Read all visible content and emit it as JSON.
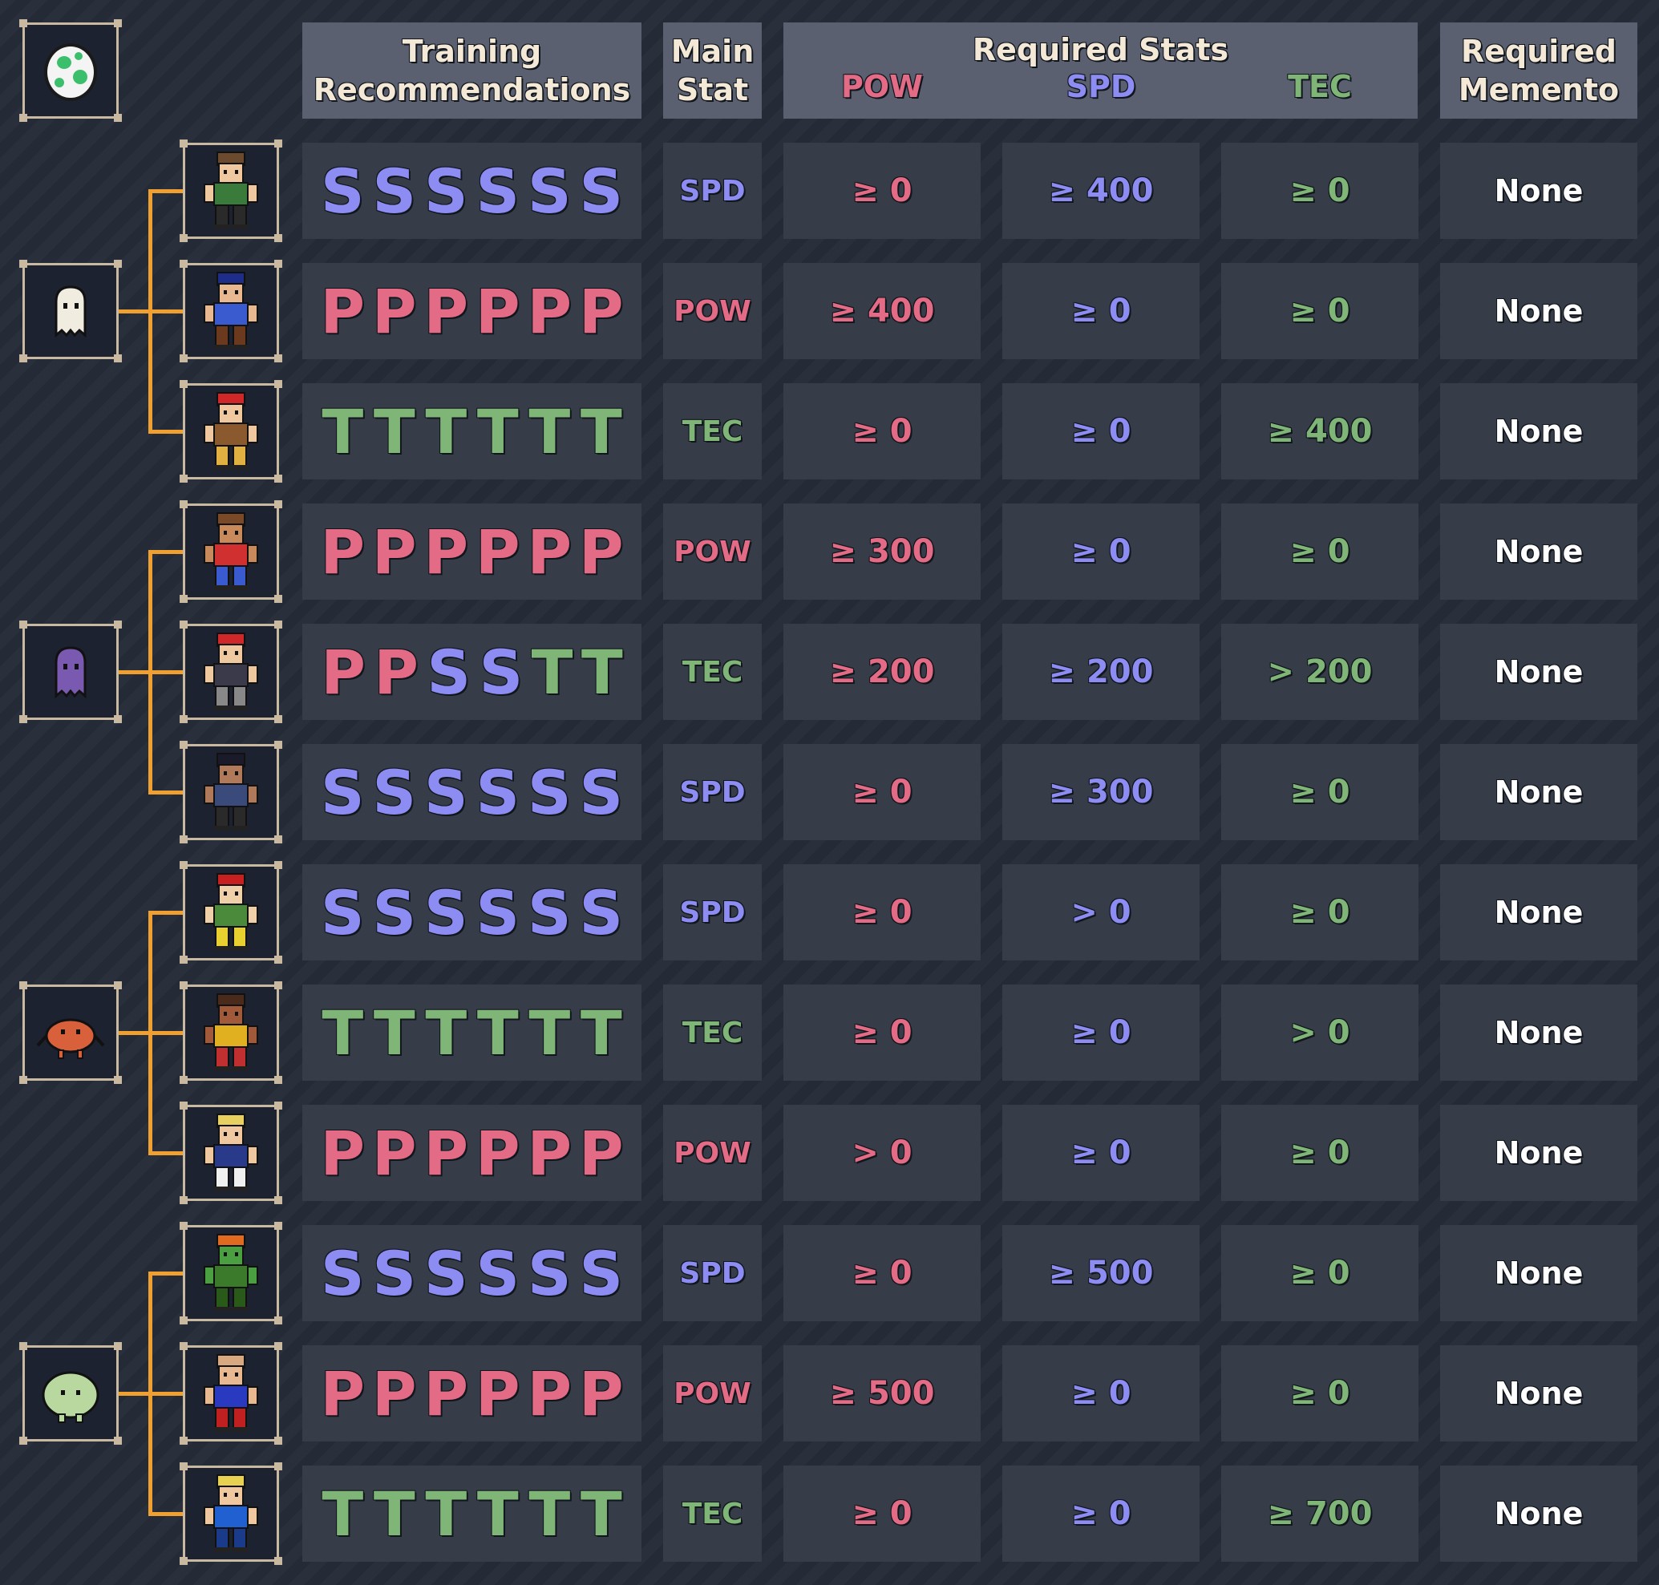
{
  "header": {
    "training_line1": "Training",
    "training_line2": "Recommendations",
    "main_line1": "Main",
    "main_line2": "Stat",
    "required_stats": "Required Stats",
    "pow": "POW",
    "spd": "SPD",
    "tec": "TEC",
    "memento_line1": "Required",
    "memento_line2": "Memento"
  },
  "colors": {
    "pow": "#e46b85",
    "spd": "#8c8cf2",
    "tec": "#7fb577",
    "connector": "#f0a030"
  },
  "groups": [
    {
      "baby_icon": "ghost-baby-icon",
      "rows": [
        0,
        1,
        2
      ]
    },
    {
      "baby_icon": "purple-blob-baby-icon",
      "rows": [
        3,
        4,
        5
      ]
    },
    {
      "baby_icon": "red-crab-baby-icon",
      "rows": [
        6,
        7,
        8
      ]
    },
    {
      "baby_icon": "green-blob-baby-icon",
      "rows": [
        9,
        10,
        11
      ]
    }
  ],
  "rows": [
    {
      "fighter_icon": "fighter-green-beret-icon",
      "training": [
        "S",
        "S",
        "S",
        "S",
        "S",
        "S"
      ],
      "main": "SPD",
      "pow": "≥ 0",
      "spd": "≥ 400",
      "tec": "≥ 0",
      "memento": "None"
    },
    {
      "fighter_icon": "fighter-police-icon",
      "training": [
        "P",
        "P",
        "P",
        "P",
        "P",
        "P"
      ],
      "main": "POW",
      "pow": "≥ 400",
      "spd": "≥ 0",
      "tec": "≥ 0",
      "memento": "None"
    },
    {
      "fighter_icon": "fighter-red-hair-icon",
      "training": [
        "T",
        "T",
        "T",
        "T",
        "T",
        "T"
      ],
      "main": "TEC",
      "pow": "≥ 0",
      "spd": "≥ 0",
      "tec": "≥ 400",
      "memento": "None"
    },
    {
      "fighter_icon": "fighter-boxer-icon",
      "training": [
        "P",
        "P",
        "P",
        "P",
        "P",
        "P"
      ],
      "main": "POW",
      "pow": "≥ 300",
      "spd": "≥ 0",
      "tec": "≥ 0",
      "memento": "None"
    },
    {
      "fighter_icon": "fighter-long-hair-icon",
      "training": [
        "P",
        "P",
        "S",
        "S",
        "T",
        "T"
      ],
      "main": "TEC",
      "pow": "≥ 200",
      "spd": "≥ 200",
      "tec": "> 200",
      "memento": "None"
    },
    {
      "fighter_icon": "fighter-twin-buns-icon",
      "training": [
        "S",
        "S",
        "S",
        "S",
        "S",
        "S"
      ],
      "main": "SPD",
      "pow": "≥ 0",
      "spd": "≥ 300",
      "tec": "≥ 0",
      "memento": "None"
    },
    {
      "fighter_icon": "fighter-braids-icon",
      "training": [
        "S",
        "S",
        "S",
        "S",
        "S",
        "S"
      ],
      "main": "SPD",
      "pow": "≥ 0",
      "spd": "> 0",
      "tec": "≥ 0",
      "memento": "None"
    },
    {
      "fighter_icon": "fighter-yellow-pants-icon",
      "training": [
        "T",
        "T",
        "T",
        "T",
        "T",
        "T"
      ],
      "main": "TEC",
      "pow": "≥ 0",
      "spd": "≥ 0",
      "tec": "> 0",
      "memento": "None"
    },
    {
      "fighter_icon": "fighter-blonde-icon",
      "training": [
        "P",
        "P",
        "P",
        "P",
        "P",
        "P"
      ],
      "main": "POW",
      "pow": "> 0",
      "spd": "≥ 0",
      "tec": "≥ 0",
      "memento": "None"
    },
    {
      "fighter_icon": "fighter-green-beast-icon",
      "training": [
        "S",
        "S",
        "S",
        "S",
        "S",
        "S"
      ],
      "main": "SPD",
      "pow": "≥ 0",
      "spd": "≥ 500",
      "tec": "≥ 0",
      "memento": "None"
    },
    {
      "fighter_icon": "fighter-bald-icon",
      "training": [
        "P",
        "P",
        "P",
        "P",
        "P",
        "P"
      ],
      "main": "POW",
      "pow": "≥ 500",
      "spd": "≥ 0",
      "tec": "≥ 0",
      "memento": "None"
    },
    {
      "fighter_icon": "fighter-blue-suit-icon",
      "training": [
        "T",
        "T",
        "T",
        "T",
        "T",
        "T"
      ],
      "main": "TEC",
      "pow": "≥ 0",
      "spd": "≥ 0",
      "tec": "≥ 700",
      "memento": "None"
    }
  ]
}
